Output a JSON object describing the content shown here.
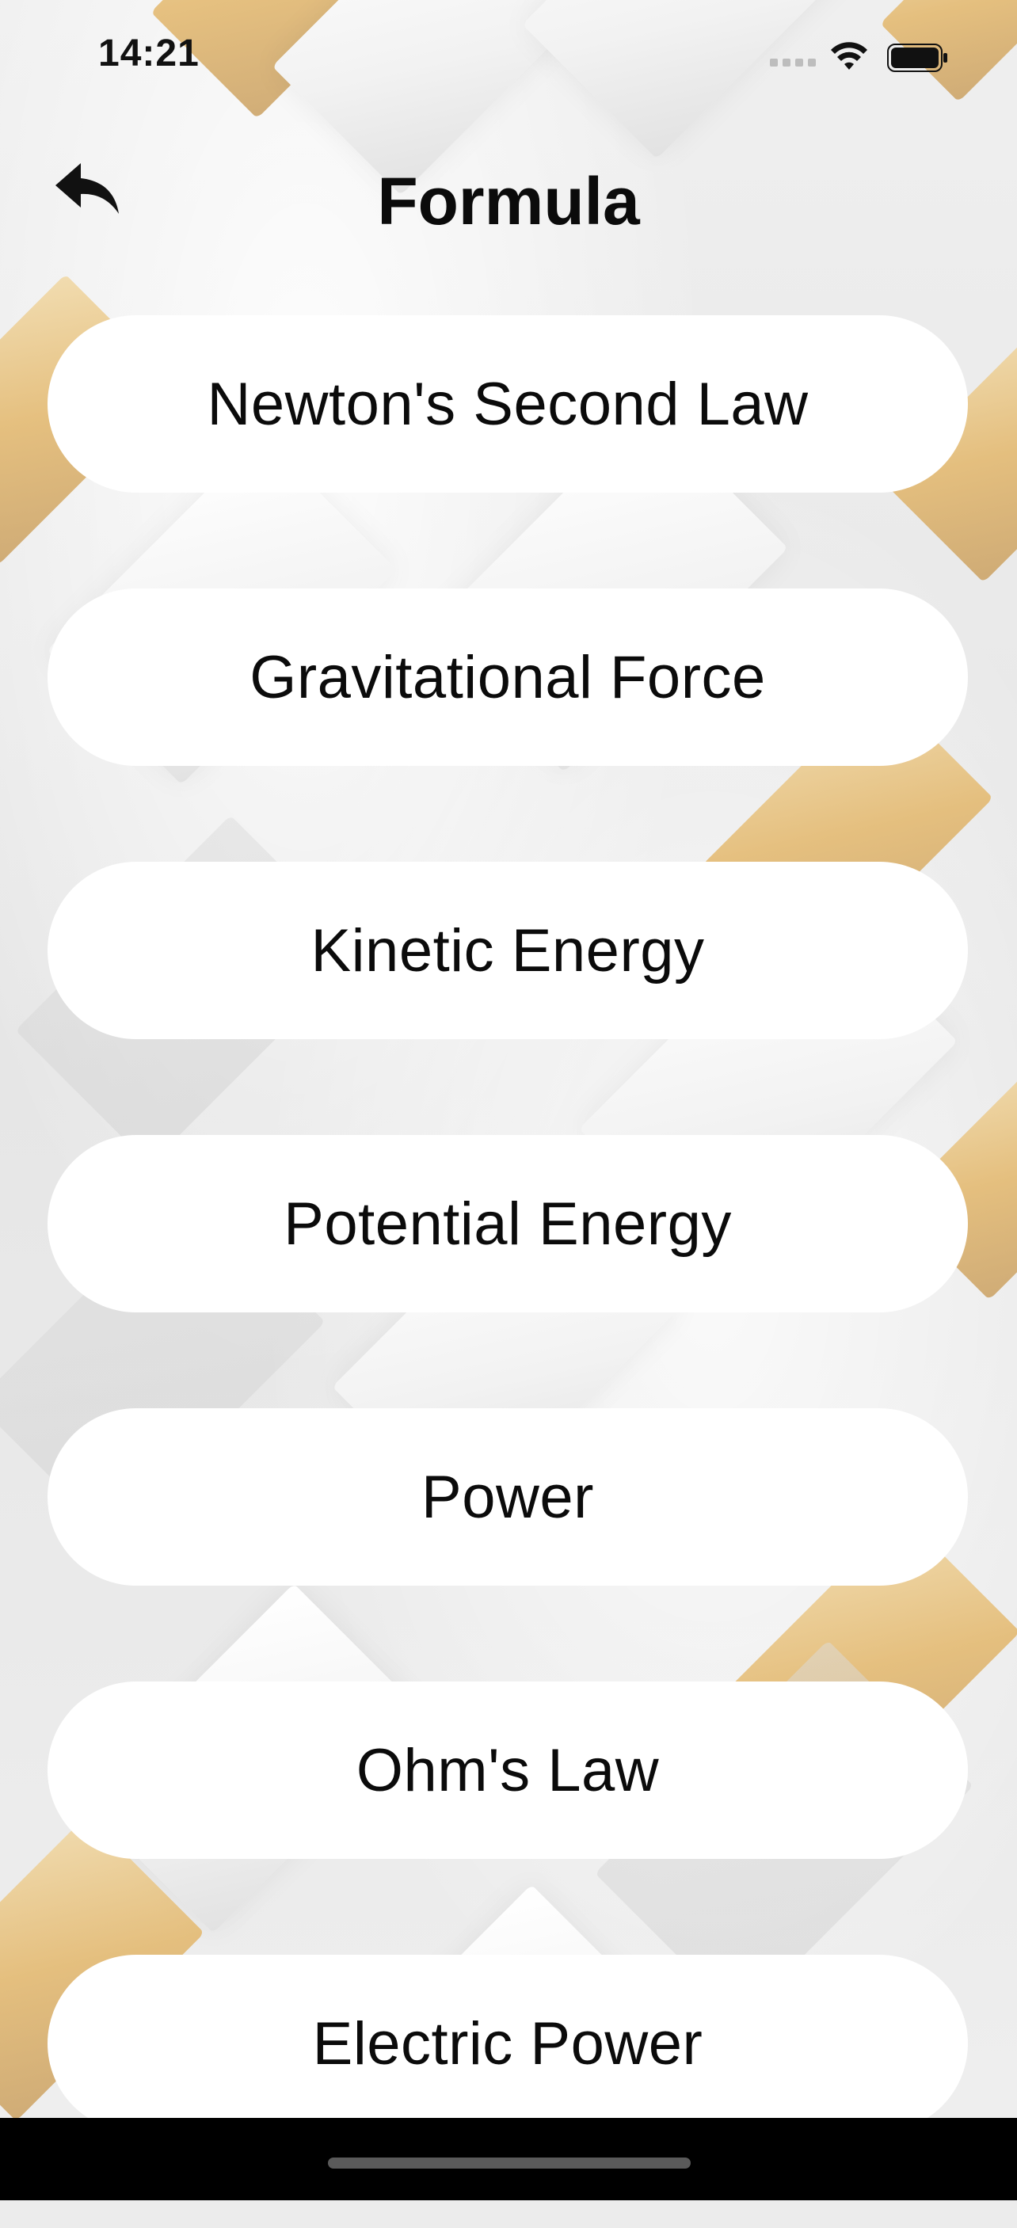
{
  "status_bar": {
    "time": "14:21",
    "wifi_icon": "wifi-icon",
    "battery_icon": "battery-icon",
    "signal_icon": "cellular-signal-icon"
  },
  "header": {
    "back_icon": "reply-arrow-icon",
    "title": "Formula"
  },
  "formulas": [
    "Newton's Second Law",
    "Gravitational Force",
    "Kinetic Energy",
    "Potential Energy",
    "Power",
    "Ohm's Law",
    "Electric Power"
  ],
  "colors": {
    "accent_gold": "#e3b76b",
    "pill_background": "#ffffff",
    "text": "#0b0b0b",
    "bottom_bar": "#000000"
  }
}
